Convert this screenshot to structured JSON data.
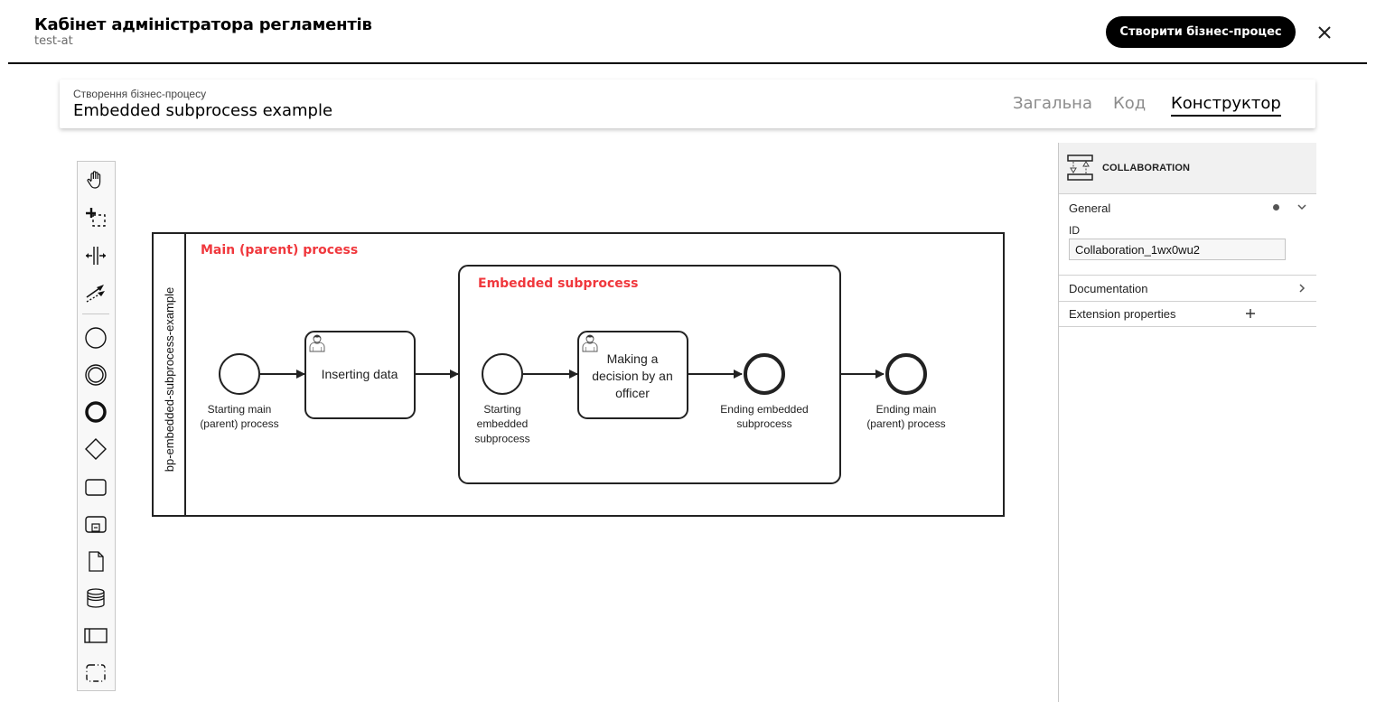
{
  "header": {
    "title": "Кабінет адміністратора регламентів",
    "subtitle": "test-at",
    "create_button": "Створити бізнес-процес",
    "close_icon": "close-icon"
  },
  "card": {
    "breadcrumb": "Створення бізнес-процесу",
    "title": "Embedded subprocess example",
    "tabs": [
      {
        "label": "Загальна",
        "active": false
      },
      {
        "label": "Код",
        "active": false
      },
      {
        "label": "Конструктор",
        "active": true
      }
    ]
  },
  "palette": {
    "tools": [
      {
        "icon": "hand-tool-icon"
      },
      {
        "icon": "lasso-tool-icon"
      },
      {
        "icon": "space-tool-icon"
      },
      {
        "icon": "global-connect-tool-icon"
      },
      {
        "icon": "start-event-icon"
      },
      {
        "icon": "intermediate-event-icon"
      },
      {
        "icon": "end-event-icon"
      },
      {
        "icon": "gateway-icon"
      },
      {
        "icon": "task-icon"
      },
      {
        "icon": "subprocess-icon"
      },
      {
        "icon": "data-object-icon"
      },
      {
        "icon": "data-store-icon"
      },
      {
        "icon": "pool-icon"
      },
      {
        "icon": "group-icon"
      }
    ]
  },
  "diagram": {
    "pool_label": "bp-embedded-subprocess-example",
    "main_annotation": "Main (parent) process",
    "sub_annotation": "Embedded subprocess",
    "annotation_color": "#f0383d",
    "elements": {
      "start_main": "Starting main\n(parent) process",
      "task_insert": "Inserting data",
      "start_sub": "Starting\nembedded\nsubprocess",
      "task_decision": "Making a\ndecision by an\nofficer",
      "end_sub": "Ending embedded\nsubprocess",
      "end_main": "Ending main\n(parent) process"
    }
  },
  "properties": {
    "element_type": "COLLABORATION",
    "general_label": "General",
    "id_label": "ID",
    "id_value": "Collaboration_1wx0wu2",
    "documentation_label": "Documentation",
    "extension_label": "Extension properties"
  }
}
